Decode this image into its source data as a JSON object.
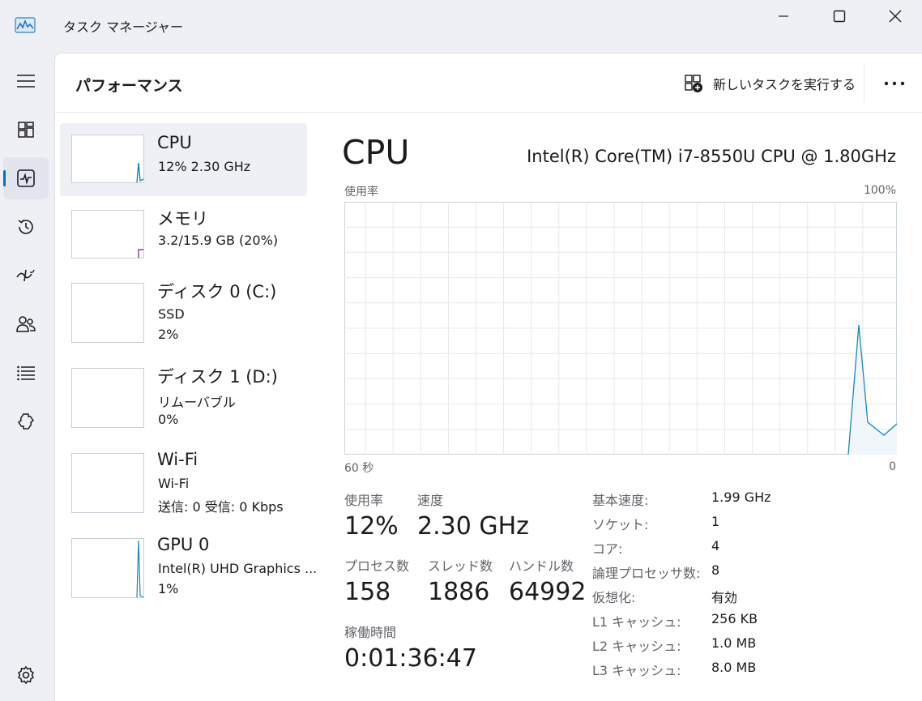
{
  "window": {
    "title": "タスク マネージャー"
  },
  "nav": [
    {
      "name": "menu-icon"
    },
    {
      "name": "processes-icon"
    },
    {
      "name": "performance-icon"
    },
    {
      "name": "app-history-icon"
    },
    {
      "name": "startup-apps-icon"
    },
    {
      "name": "users-icon"
    },
    {
      "name": "details-icon"
    },
    {
      "name": "services-icon"
    },
    {
      "name": "settings-icon"
    }
  ],
  "header": {
    "title": "パフォーマンス",
    "run_task_label": "新しいタスクを実行する"
  },
  "devices": [
    {
      "name": "CPU",
      "line1": "12%  2.30 GHz",
      "line2": "",
      "color": "#1a86ba"
    },
    {
      "name": "メモリ",
      "line1": "3.2/15.9 GB (20%)",
      "line2": "",
      "color": "#9b2fae"
    },
    {
      "name": "ディスク 0 (C:)",
      "line1": "SSD",
      "line2": "2%",
      "color": "#4e9a06"
    },
    {
      "name": "ディスク 1 (D:)",
      "line1": "リムーバブル",
      "line2": "0%",
      "color": "#4e9a06"
    },
    {
      "name": "Wi-Fi",
      "line1": "Wi-Fi",
      "line2": "送信: 0 受信: 0 Kbps",
      "color": "#b35c00"
    },
    {
      "name": "GPU 0",
      "line1": "Intel(R) UHD Graphics ...",
      "line2": "1%",
      "color": "#1a86ba"
    }
  ],
  "detail": {
    "title": "CPU",
    "model": "Intel(R) Core(TM) i7-8550U CPU @ 1.80GHz",
    "graph_top_left": "使用率",
    "graph_top_right": "100%",
    "graph_bottom_left": "60 秒",
    "graph_bottom_right": "0",
    "stats": {
      "usage_label": "使用率",
      "usage_value": "12%",
      "speed_label": "速度",
      "speed_value": "2.30 GHz",
      "processes_label": "プロセス数",
      "processes_value": "158",
      "threads_label": "スレッド数",
      "threads_value": "1886",
      "handles_label": "ハンドル数",
      "handles_value": "64992",
      "uptime_label": "稼働時間",
      "uptime_value": "0:01:36:47"
    },
    "specs": [
      {
        "key": "基本速度:",
        "value": "1.99 GHz"
      },
      {
        "key": "ソケット:",
        "value": "1"
      },
      {
        "key": "コア:",
        "value": "4"
      },
      {
        "key": "論理プロセッサ数:",
        "value": "8"
      },
      {
        "key": "仮想化:",
        "value": "有効"
      },
      {
        "key": "L1 キャッシュ:",
        "value": "256 KB"
      },
      {
        "key": "L2 キャッシュ:",
        "value": "1.0 MB"
      },
      {
        "key": "L3 キャッシュ:",
        "value": "8.0 MB"
      }
    ]
  },
  "colors": {
    "cpu_line": "#1a86ba",
    "cpu_fill": "#f1f6fa",
    "grid": "#e3e8ec",
    "accent": "#0f6cbd"
  }
}
